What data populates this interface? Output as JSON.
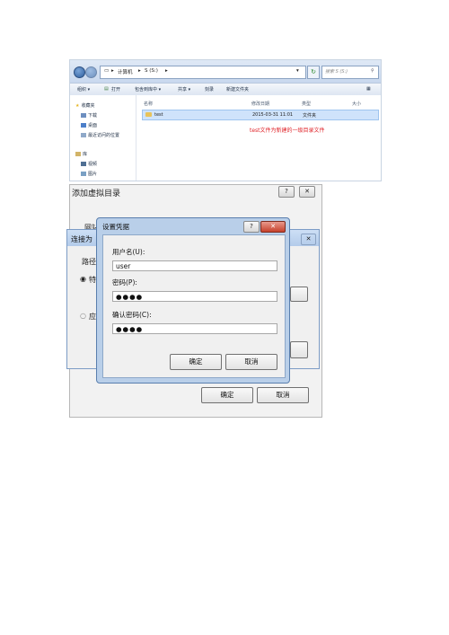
{
  "explorer": {
    "address": [
      "计算机",
      "S (S:)"
    ],
    "search_placeholder": "搜索 S (S:)",
    "toolbar": [
      "组织 ▾",
      "打开",
      "包含到库中 ▾",
      "共享 ▾",
      "刻录",
      "新建文件夹"
    ],
    "nav_items": [
      "收藏夹",
      "下载",
      "桌面",
      "最近访问的位置",
      "库",
      "视频",
      "图片"
    ],
    "columns": [
      "名称",
      "修改日期",
      "类型",
      "大小"
    ],
    "file": {
      "name": "test",
      "date": "2015-03-31 11:01",
      "type": "文件夹"
    }
  },
  "annotation": "test文件为新建的一级目录文件",
  "add_vdir_dialog": {
    "title": "添加虚拟目录",
    "help": "?",
    "close": "✕",
    "partial_label": "网站",
    "ok": "确定",
    "cancel": "取消"
  },
  "connect_as_dialog": {
    "title": "连接为",
    "close": "✕",
    "path_partial": "路径",
    "option1_partial": "特",
    "option2_partial": "应"
  },
  "credentials_dialog": {
    "title": "设置凭据",
    "help": "?",
    "close": "✕",
    "username_label": "用户名(U):",
    "username_value": "user",
    "password_label": "密码(P):",
    "password_value": "●●●●",
    "confirm_label": "确认密码(C):",
    "confirm_value": "●●●●",
    "ok": "确定",
    "cancel": "取消"
  },
  "colors": {
    "accent_blue": "#b9cfe9",
    "annotation_red": "#e0242a",
    "selection": "#cfe3fb"
  }
}
